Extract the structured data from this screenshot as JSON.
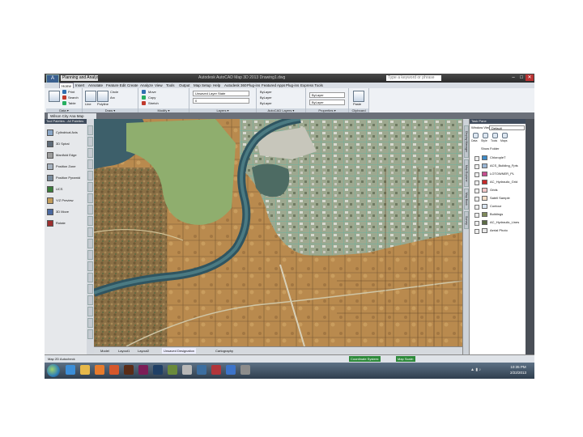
{
  "window": {
    "title": "Autodesk AutoCAD Map 3D 2013  Drawing1.dwg",
    "qa_label": "Planning and Analysis",
    "app_button": "A",
    "search_placeholder": "Type a keyword or phrase",
    "controls": [
      "–",
      "□",
      "✕"
    ]
  },
  "ribbon_tabs": [
    "Home",
    "Insert",
    "Annotate",
    "Feature Edit",
    "Create",
    "Analyze",
    "View",
    "Tools",
    "Output",
    "Map Setup",
    "Help",
    "Autodesk 360",
    "Plug-ins",
    "Featured Apps",
    "Plug-ins",
    "Express Tools"
  ],
  "ribbon": {
    "groups": [
      {
        "label": "Data ▾",
        "items": [
          "Print",
          "Search",
          "Table"
        ]
      },
      {
        "label": "Draw ▾",
        "items": [
          "Line",
          "Polyline",
          "Circle",
          "Arc"
        ]
      },
      {
        "label": "Modify ▾",
        "items": [
          "Move",
          "Copy",
          "Stretch"
        ]
      },
      {
        "label": "Layers ▾",
        "items": [
          "Unsaved Layer State",
          "0"
        ]
      },
      {
        "label": "AutoCAD Layers ▾",
        "items": [
          "ByLayer",
          "ByLayer",
          "ByLayer"
        ]
      },
      {
        "label": "Properties ▾",
        "items": [
          "ByLayer",
          "ByLayer"
        ]
      },
      {
        "label": "Clipboard",
        "items": [
          "Paste"
        ]
      }
    ],
    "icon_colors": [
      "#2f6fb0",
      "#c0392b",
      "#27ae60",
      "#e1a31b",
      "#6c3d91"
    ]
  },
  "doc_tab": "Wilson City Ana Map",
  "palette": {
    "title": "Tool Palettes - All Palettes",
    "items": [
      "Cylindrical Axis",
      "3D Spiral",
      "Manifold Edge",
      "Position Zone",
      "Position Pyramid",
      "UCS",
      "Y/Z Preview",
      "3D Move",
      "Rotate"
    ],
    "icon_colors": [
      "#8aa7c8",
      "#5e6b78",
      "#9d9d9d",
      "#a6b2bf",
      "#7a8c9e",
      "#3b7c3b",
      "#c29c5a",
      "#4a68a0",
      "#9c2f2f"
    ]
  },
  "map_tabs": [
    "Model",
    "Layout1",
    "Layout2"
  ],
  "map_status": [
    "Unsaved Designation",
    "Cartography"
  ],
  "task_pane": {
    "title": "Task Pane",
    "vertical_tabs": [
      "Display Manager",
      "Map Explorer",
      "Map Book",
      "Survey"
    ],
    "map_label": "Window View:",
    "map_select": "Default",
    "tools": [
      "Data",
      "Style",
      "Tools",
      "Maps"
    ],
    "show_layers": "Show Folder",
    "layers": [
      {
        "name": "ChloropleT",
        "color": "#3d8ac7"
      },
      {
        "name": "ACS_Building_Fpts",
        "color": "#9ab6d6"
      },
      {
        "name": "LOTOWNER_PL",
        "color": "#c64d8f"
      },
      {
        "name": "AC_Hydraulic_Grid",
        "color": "#c62828"
      },
      {
        "name": "Grids",
        "color": "#f1c6c6"
      },
      {
        "name": "Satell Sample",
        "color": "#f3ddc6"
      },
      {
        "name": "Contour",
        "color": "#dbe6f3"
      },
      {
        "name": "Buildings",
        "color": "#7f8a5a"
      },
      {
        "name": "AC_Hydraulic_Lines",
        "color": "#5c6b45"
      },
      {
        "name": "Aerial Photo",
        "color": "#e8e8e8"
      }
    ]
  },
  "statusbar": {
    "left": "Map  2D  Autocheck",
    "coordinate_system": "Coordinate System:",
    "map_scale": "Map Scale:"
  },
  "taskbar": {
    "icons": [
      {
        "name": "internet-explorer-icon",
        "color": "#3b8ed8"
      },
      {
        "name": "folder-icon",
        "color": "#e6b84a"
      },
      {
        "name": "media-player-icon",
        "color": "#e77b2c"
      },
      {
        "name": "firefox-icon",
        "color": "#d5572b"
      },
      {
        "name": "illustrator-icon",
        "color": "#5a2c17"
      },
      {
        "name": "indesign-icon",
        "color": "#7b1d57"
      },
      {
        "name": "photoshop-icon",
        "color": "#1f3f66"
      },
      {
        "name": "app-icon-1",
        "color": "#6a8a3c"
      },
      {
        "name": "app-icon-2",
        "color": "#b7b7b7"
      },
      {
        "name": "app-icon-3",
        "color": "#3c6ea0"
      },
      {
        "name": "app-icon-4",
        "color": "#b1353b"
      },
      {
        "name": "autocad-map-icon",
        "color": "#3c73c9"
      },
      {
        "name": "app-icon-5",
        "color": "#8c8c8c"
      }
    ],
    "time": "10:35 PM",
    "date": "2/22/2013"
  }
}
